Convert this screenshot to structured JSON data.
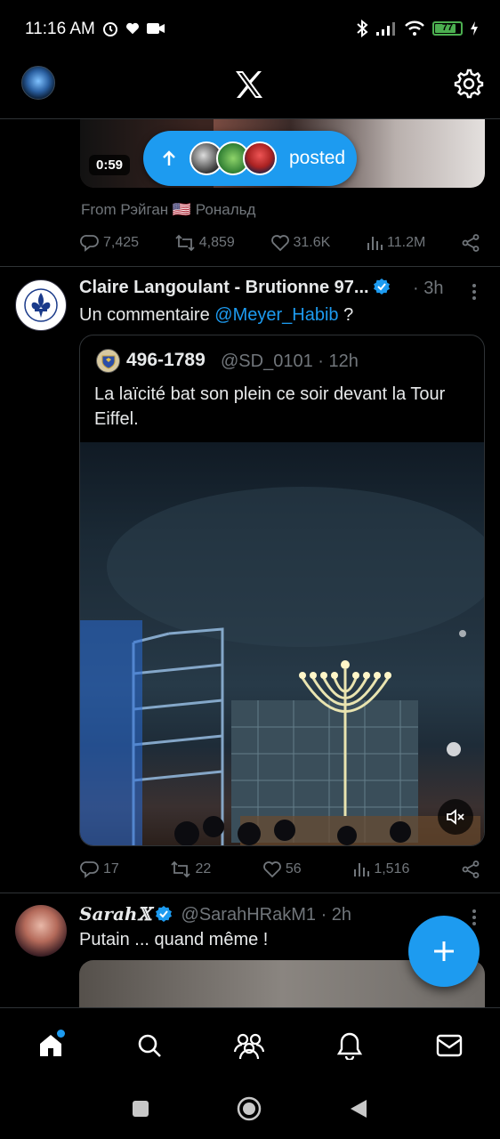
{
  "status_bar": {
    "time": "11:16 AM",
    "battery": "77"
  },
  "header": {
    "logo": "X",
    "icons": {
      "profile": "profile-avatar",
      "settings": "gear-icon"
    }
  },
  "post1": {
    "video_time": "0:59",
    "posted_pill_label": "posted",
    "from_text": "From Рэйган 🇺🇸 Рональд",
    "stats": {
      "replies": "7,425",
      "reposts": "4,859",
      "likes": "31.6K",
      "views": "11.2M"
    }
  },
  "post2": {
    "author_name": "Claire Langoulant - Brutionne 97...",
    "verified": true,
    "time": "3h",
    "text_prefix": "Un commentaire ",
    "mention": "@Meyer_Habib",
    "text_suffix": " ?",
    "quote": {
      "author_name": "496-1789",
      "handle": "@SD_0101",
      "time": "12h",
      "text": "La laïcité bat son plein ce soir devant la Tour Eiffel."
    },
    "stats": {
      "replies": "17",
      "reposts": "22",
      "likes": "56",
      "views": "1,516"
    }
  },
  "post3": {
    "author_name": "Sarah𝕏",
    "verified": true,
    "handle": "@SarahHRakM1",
    "time": "2h",
    "text": "Putain ... quand même !"
  },
  "bottom_nav": {
    "items": [
      "home",
      "search",
      "communities",
      "notifications",
      "messages"
    ]
  },
  "colors": {
    "accent": "#1d9bf0",
    "background": "#000000",
    "text_primary": "#e7e9ea",
    "text_secondary": "#71767b",
    "divider": "#2f3336"
  }
}
